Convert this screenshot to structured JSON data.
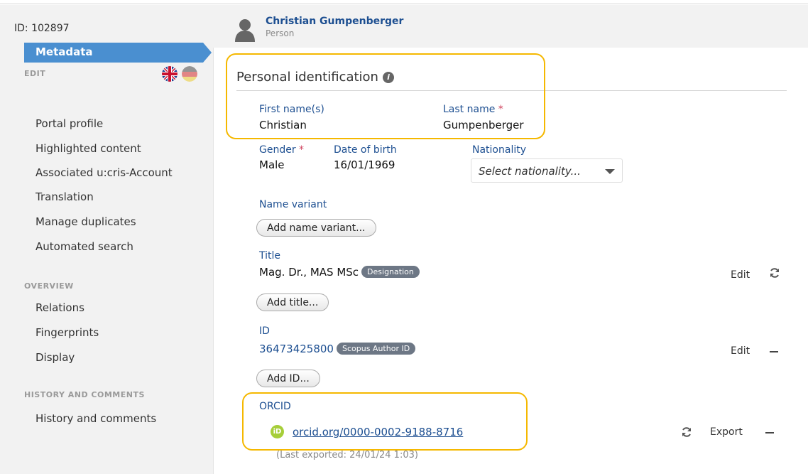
{
  "header": {
    "id_text": "ID: 102897",
    "name": "Christian Gumpenberger",
    "type": "Person"
  },
  "sidebar": {
    "edit_heading": "EDIT",
    "active_item": "Metadata",
    "edit_items": [
      "Portal profile",
      "Highlighted content",
      "Associated u:cris-Account",
      "Translation",
      "Manage duplicates",
      "Automated search"
    ],
    "overview_heading": "OVERVIEW",
    "overview_items": [
      "Relations",
      "Fingerprints",
      "Display"
    ],
    "history_heading": "HISTORY AND COMMENTS",
    "history_items": [
      "History and comments"
    ]
  },
  "personal": {
    "title": "Personal identification",
    "first_name_label": "First name(s)",
    "first_name": "Christian",
    "last_name_label": "Last name",
    "last_name": "Gumpenberger",
    "required_mark": "*",
    "gender_label": "Gender",
    "gender": "Male",
    "dob_label": "Date of birth",
    "dob": "16/01/1969",
    "nationality_label": "Nationality",
    "nationality_placeholder": "Select nationality..."
  },
  "name_variant": {
    "label": "Name variant",
    "add_button": "Add name variant..."
  },
  "title_section": {
    "label": "Title",
    "value": "Mag. Dr., MAS MSc",
    "badge": "Designation",
    "edit": "Edit",
    "add_button": "Add title..."
  },
  "id_section": {
    "label": "ID",
    "value": "36473425800",
    "badge": "Scopus Author ID",
    "edit": "Edit",
    "add_button": "Add ID..."
  },
  "orcid": {
    "label": "ORCID",
    "icon_text": "iD",
    "link": "orcid.org/0000-0002-9188-8716",
    "export": "Export",
    "last_exported": "(Last exported: 24/01/24 1:03)"
  },
  "colors": {
    "highlight": "#f5b800",
    "accent": "#4a8fd0",
    "link": "#1d4f91"
  }
}
